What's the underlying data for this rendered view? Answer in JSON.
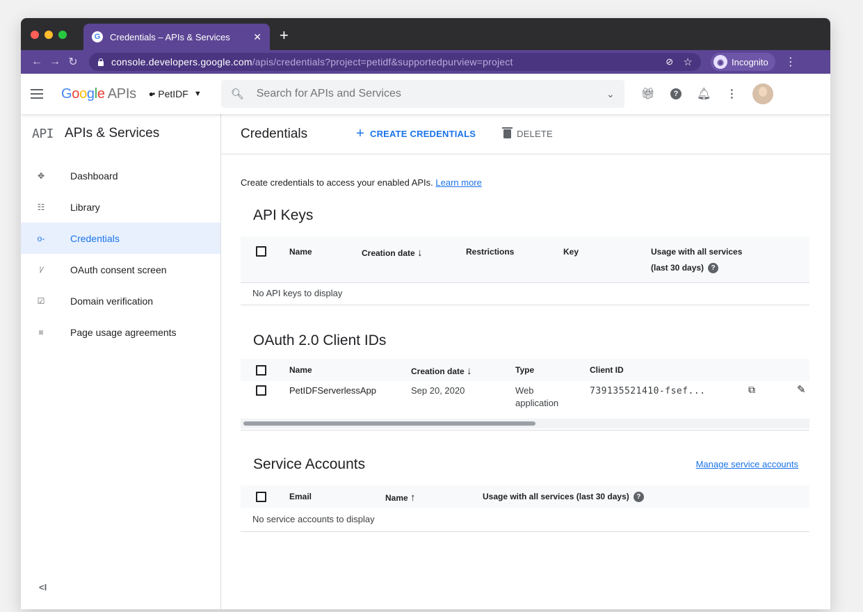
{
  "browser": {
    "tab_title": "Credentials – APIs & Services",
    "new_tab_symbol": "+",
    "url_host": "console.developers.google.com",
    "url_path": "/apis/credentials?project=petidf&supportedpurview=project",
    "incognito_label": "Incognito"
  },
  "header": {
    "logo_google": [
      "G",
      "o",
      "o",
      "g",
      "l",
      "e"
    ],
    "logo_apis": "APIs",
    "project_name": "PetIDF",
    "search_placeholder": "Search for APIs and Services"
  },
  "sidebar": {
    "title": "APIs & Services",
    "logo_text": "API",
    "items": [
      {
        "label": "Dashboard",
        "icon": "dashboard-icon",
        "active": false
      },
      {
        "label": "Library",
        "icon": "library-icon",
        "active": false
      },
      {
        "label": "Credentials",
        "icon": "key-icon",
        "active": true
      },
      {
        "label": "OAuth consent screen",
        "icon": "consent-icon",
        "active": false
      },
      {
        "label": "Domain verification",
        "icon": "checkbox-icon",
        "active": false
      },
      {
        "label": "Page usage agreements",
        "icon": "settings-list-icon",
        "active": false
      }
    ],
    "collapse_label": "<I"
  },
  "page": {
    "title": "Credentials",
    "create_label": "CREATE CREDENTIALS",
    "delete_label": "DELETE",
    "intro_text": "Create credentials to access your enabled APIs.",
    "learn_more": "Learn more"
  },
  "api_keys": {
    "title": "API Keys",
    "columns": [
      "Name",
      "Creation date",
      "Restrictions",
      "Key",
      "Usage with all services",
      "(last 30 days)"
    ],
    "empty": "No API keys to display"
  },
  "oauth": {
    "title": "OAuth 2.0 Client IDs",
    "columns": [
      "Name",
      "Creation date",
      "Type",
      "Client ID"
    ],
    "rows": [
      {
        "name": "PetIDFServerlessApp",
        "date": "Sep 20, 2020",
        "type_line1": "Web",
        "type_line2": "application",
        "client_id": "739135521410-fsef..."
      }
    ]
  },
  "service_accounts": {
    "title": "Service Accounts",
    "manage_link": "Manage service accounts",
    "columns": [
      "Email",
      "Name",
      "Usage with all services (last 30 days)"
    ],
    "empty": "No service accounts to display"
  },
  "colors": {
    "accent": "#1a73e8",
    "incognito_purple": "#5c4594",
    "active_bg": "#e8f0fe"
  }
}
